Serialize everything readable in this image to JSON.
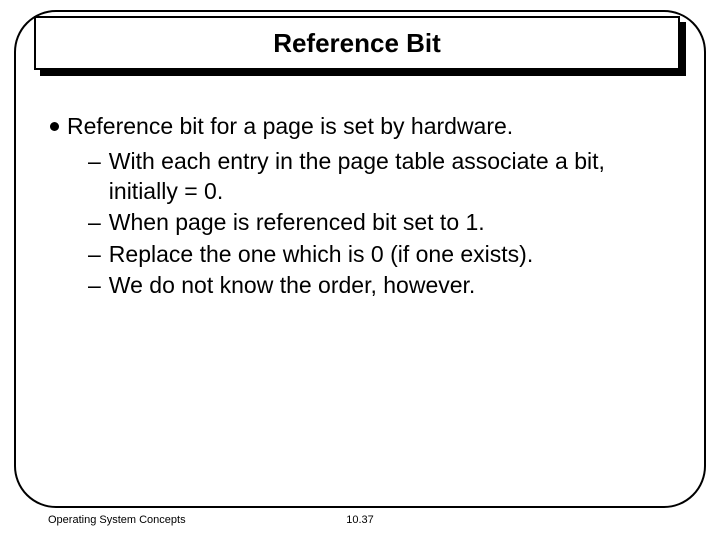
{
  "title": "Reference Bit",
  "bullet": "Reference bit for a page is set by hardware.",
  "subitems": [
    "With each entry in the page table associate a bit, initially = 0.",
    "When page is referenced bit set to 1.",
    "Replace the one which is 0 (if one exists).",
    "We do not know the order, however."
  ],
  "footer_left": "Operating System Concepts",
  "footer_center": "10.37"
}
